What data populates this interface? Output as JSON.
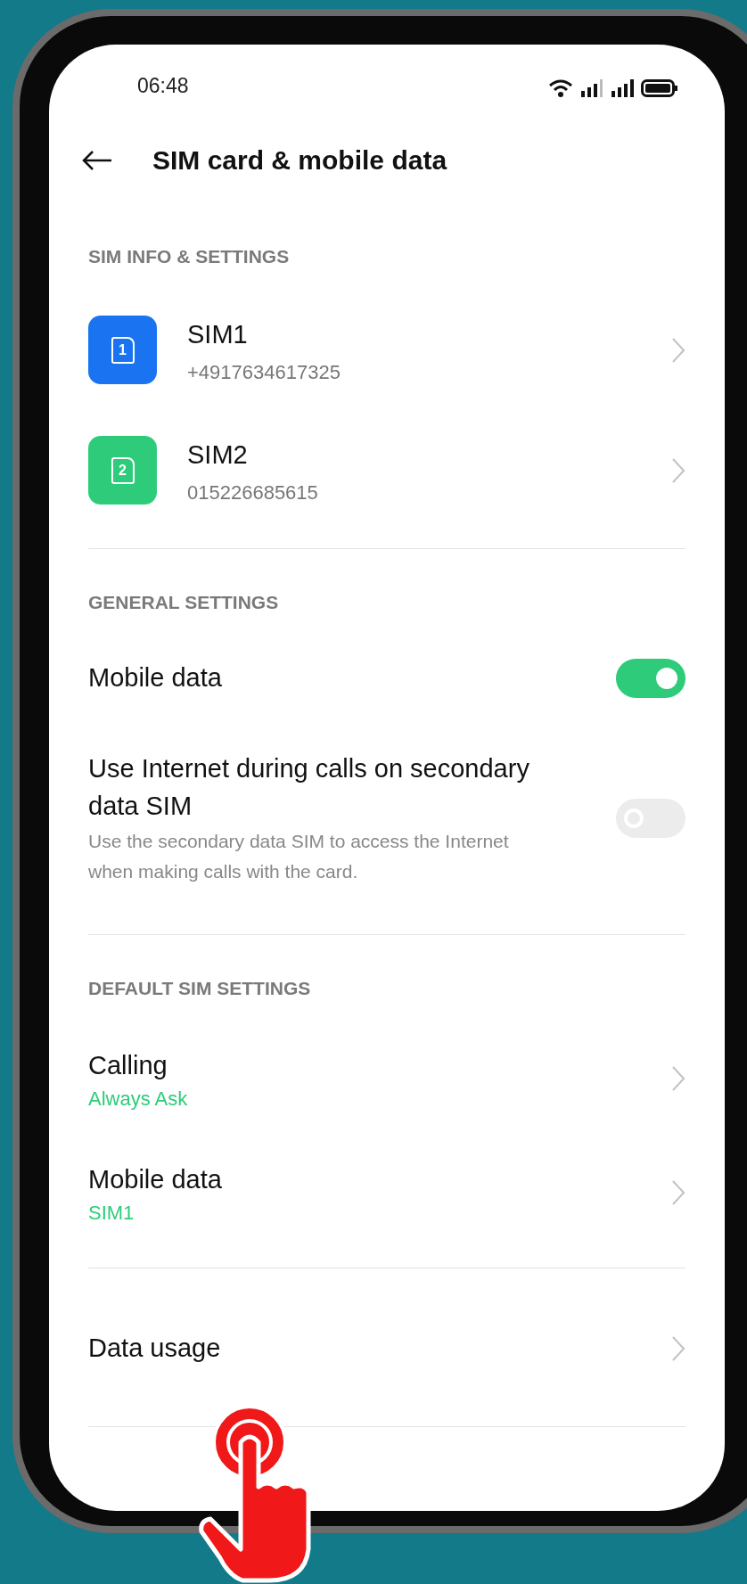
{
  "status_bar": {
    "time": "06:48"
  },
  "header": {
    "title": "SIM card & mobile data"
  },
  "sections": [
    {
      "heading": "SIM INFO & SETTINGS",
      "items": [
        {
          "kind": "sim",
          "title": "SIM1",
          "subtitle": "+4917634617325",
          "badge": "1",
          "color": "#1a73f0"
        },
        {
          "kind": "sim",
          "title": "SIM2",
          "subtitle": "015226685615",
          "badge": "2",
          "color": "#2ecc7a"
        }
      ]
    },
    {
      "heading": "GENERAL SETTINGS",
      "items": [
        {
          "kind": "toggle",
          "title": "Mobile data",
          "on": true
        },
        {
          "kind": "toggle",
          "title": "Use Internet during calls on secondary data SIM",
          "description": "Use the secondary data SIM to access the Internet when making calls with the card.",
          "on": false
        }
      ]
    },
    {
      "heading": "DEFAULT SIM SETTINGS",
      "items": [
        {
          "kind": "link",
          "title": "Calling",
          "subtitle": "Always Ask"
        },
        {
          "kind": "link",
          "title": "Mobile data",
          "subtitle": "SIM1"
        }
      ]
    },
    {
      "items": [
        {
          "kind": "link",
          "title": "Data usage"
        }
      ]
    }
  ]
}
